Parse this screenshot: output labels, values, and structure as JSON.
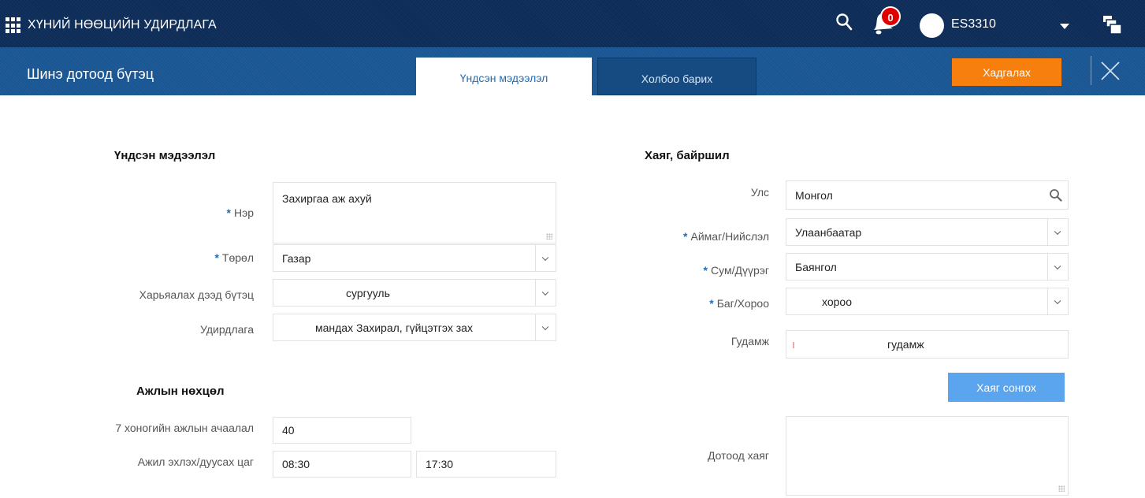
{
  "topbar": {
    "app_title": "ХҮНИЙ НӨӨЦИЙН УДИРДЛАГА",
    "notification_count": "0",
    "username": "ES3310",
    "icons": [
      "apps-grid-icon",
      "search-icon",
      "bell-icon",
      "avatar",
      "chevron-down-icon",
      "stack-icon"
    ]
  },
  "header": {
    "title": "Шинэ дотоод бүтэц",
    "tabs": [
      {
        "label": "Үндсэн мэдээлэл",
        "active": true
      },
      {
        "label": "Холбоо барих",
        "active": false
      }
    ],
    "save_label": "Хадгалах",
    "close_icon": "close-icon"
  },
  "basic": {
    "section_title": "Үндсэн мэдээлэл",
    "name": {
      "label": "Нэр",
      "value": "Захиргаа аж ахуй"
    },
    "type": {
      "label": "Төрөл",
      "value": "Газар"
    },
    "parent": {
      "label": "Харьяалах дээд бүтэц",
      "value": "сургууль"
    },
    "management": {
      "label": "Удирдлага",
      "value": "мандах Захирал, гүйцэтгэх зах"
    }
  },
  "work": {
    "section_title": "Ажлын нөхцөл",
    "weekly_load": {
      "label": "7 хоногийн ажлын ачаалал",
      "value": "40"
    },
    "hours": {
      "label": "Ажил эхлэх/дуусах цаг",
      "start": "08:30",
      "end": "17:30"
    }
  },
  "address": {
    "section_title": "Хаяг, байршил",
    "country": {
      "label": "Улс",
      "value": "Монгол"
    },
    "province": {
      "label": "Аймаг/Нийслэл",
      "value": "Улаанбаатар"
    },
    "district": {
      "label": "Сум/Дүүрэг",
      "value": "Баянгол"
    },
    "khoroo": {
      "label": "Баг/Хороо",
      "value": "хороо"
    },
    "street": {
      "label": "Гудамж",
      "value": "гудамж"
    },
    "choose_label": "Хаяг сонгох",
    "internal": {
      "label": "Дотоод хаяг",
      "value": ""
    }
  },
  "colors": {
    "topbar": "#0d2d58",
    "header": "#1a5693",
    "save_button": "#f77f0d",
    "address_button": "#5aa5ed",
    "active_tab_text": "#1f6db5"
  }
}
